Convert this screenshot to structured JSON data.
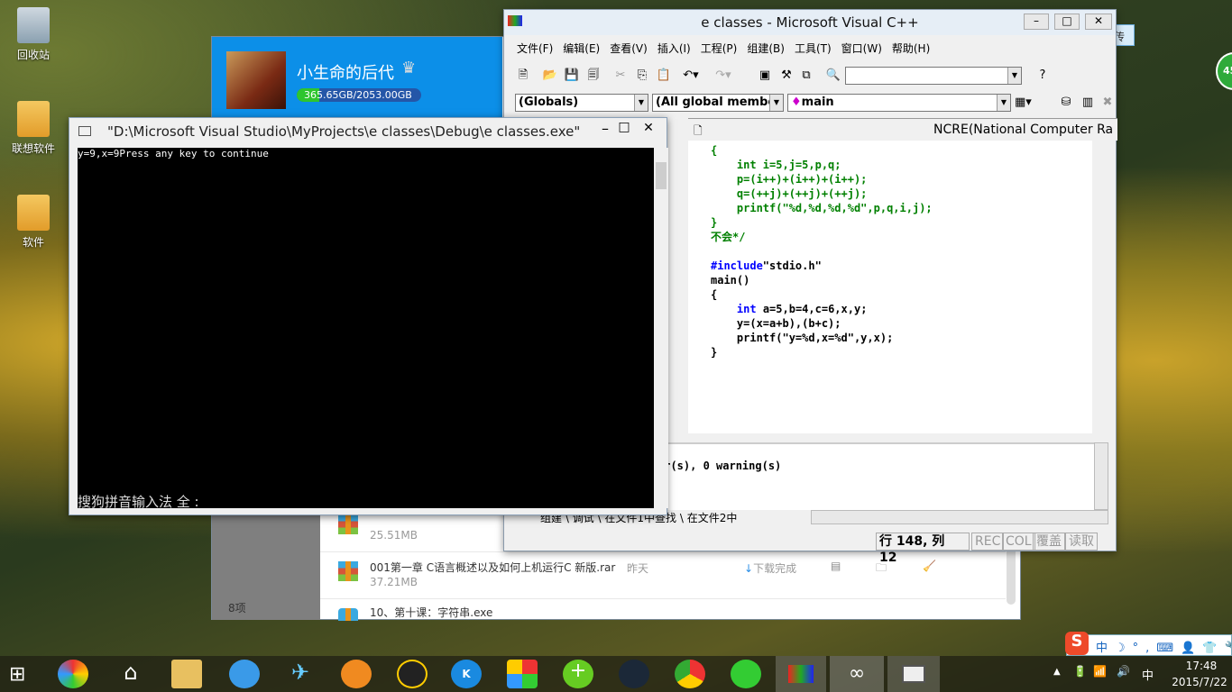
{
  "desktop": {
    "icons": [
      {
        "label": "回收站"
      },
      {
        "label": "联想软件"
      },
      {
        "label": "软件"
      }
    ]
  },
  "baidu": {
    "username": "小生命的后代",
    "quota": "365.65GB/2053.00GB",
    "quota_fraction": 0.178,
    "item_count": "8项",
    "upload_button": "拖拽上传",
    "badge": "45",
    "files": [
      {
        "name": "",
        "size": "25.51MB"
      },
      {
        "name": "001第一章 C语言概述以及如何上机运行C 新版.rar",
        "size": "37.21MB",
        "date": "昨天",
        "status": "下载完成"
      },
      {
        "name": "10、第十课：字符串.exe",
        "size": "",
        "date": "昨天",
        "status": "下载完成"
      }
    ]
  },
  "console": {
    "title": "\"D:\\Microsoft Visual Studio\\MyProjects\\e classes\\Debug\\e classes.exe\"",
    "output": "y=9,x=9Press any key to continue",
    "ime": "搜狗拼音输入法 全 :"
  },
  "vc": {
    "title": "e classes - Microsoft Visual C++",
    "menu": [
      "文件(F)",
      "编辑(E)",
      "查看(V)",
      "插入(I)",
      "工程(P)",
      "组建(B)",
      "工具(T)",
      "窗口(W)",
      "帮助(H)"
    ],
    "combo_globals": "(Globals)",
    "combo_members": "(All global members",
    "combo_func": "main",
    "doc_title": "NCRE(National Computer Ra",
    "code": [
      {
        "t": "{",
        "c": "g"
      },
      {
        "t": "    int i=5,j=5,p,q;",
        "c": "g"
      },
      {
        "t": "    p=(i++)+(i++)+(i++);",
        "c": "g"
      },
      {
        "t": "    q=(++j)+(++j)+(++j);",
        "c": "g"
      },
      {
        "t": "    printf(\"%d,%d,%d,%d\",p,q,i,j);",
        "c": "g"
      },
      {
        "t": "}",
        "c": "g"
      },
      {
        "t": "不会*/",
        "c": "g"
      },
      {
        "t": "",
        "c": "k"
      },
      {
        "t": "#include\"stdio.h\"",
        "c": "inc"
      },
      {
        "t": "main()",
        "c": "k"
      },
      {
        "t": "{",
        "c": "k"
      },
      {
        "t": "    int a=5,b=4,c=6,x,y;",
        "c": "int"
      },
      {
        "t": "    y=(x=a+b),(b+c);",
        "c": "k"
      },
      {
        "t": "    printf(\"y=%d,x=%d\",y,x);",
        "c": "k"
      },
      {
        "t": "}",
        "c": "k"
      }
    ],
    "output": "or(s), 0 warning(s)",
    "tabs": [
      "组建",
      "调试",
      "在文件1中查找",
      "在文件2中"
    ],
    "status": {
      "pos": "行 148, 列 12",
      "rec": "REC",
      "col": "COL",
      "ovr": "覆盖",
      "read": "读取"
    }
  },
  "tray": {
    "time": "17:48",
    "date": "2015/7/22",
    "ime": "中",
    "ime_bar": [
      "中",
      "☽",
      "°,",
      "⌨",
      "👤",
      "👕",
      "🔧"
    ]
  }
}
